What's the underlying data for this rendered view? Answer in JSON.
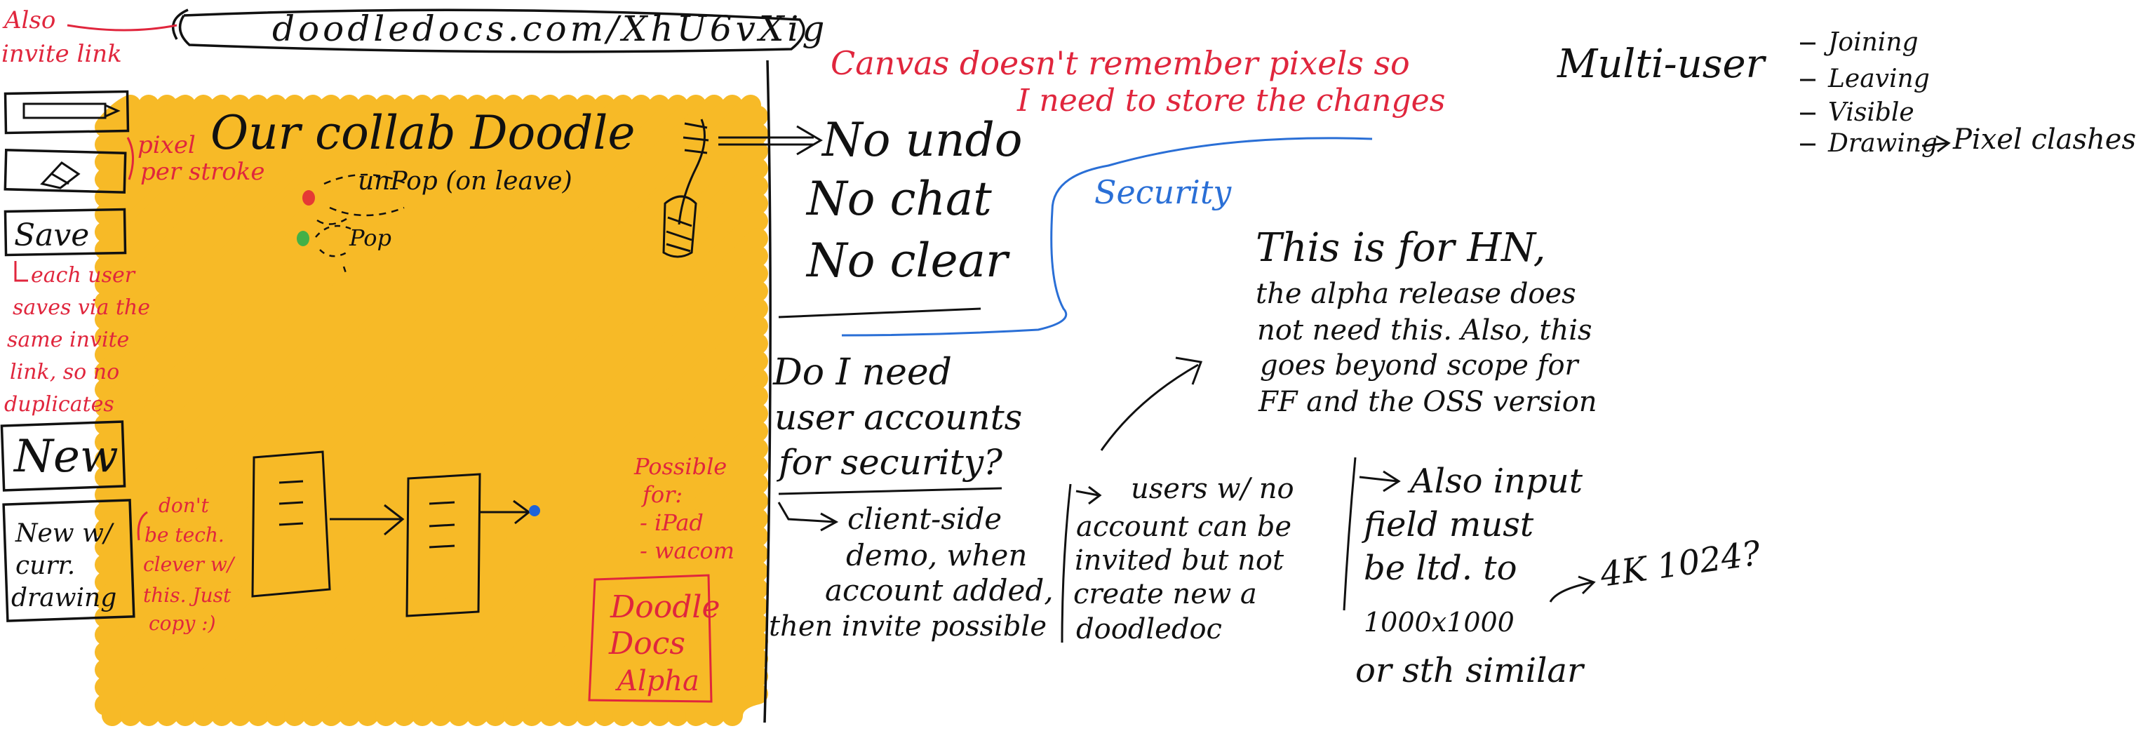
{
  "colors": {
    "ink": "#111111",
    "red": "#e0263d",
    "blue": "#2a6fd6",
    "highlight": "#f7b71c",
    "dot_red": "#e53935",
    "dot_green": "#43b047",
    "dot_blue": "#1e63d8"
  },
  "url_bar": {
    "url": "doodledocs.com/XhU6vXig"
  },
  "invite_note": {
    "line1": "Also",
    "line2": "invite link"
  },
  "toolbar": {
    "pen_icon": "pen-icon",
    "eraser_icon": "eraser-icon",
    "save_label": "Save",
    "new_label": "New",
    "new_with_current": [
      "New w/",
      "curr.",
      "drawing"
    ]
  },
  "pixel_note": {
    "line1": "pixel",
    "line2": "per stroke"
  },
  "save_note": [
    "each user",
    "saves via the",
    "same invite",
    "link, so no",
    "duplicates"
  ],
  "new_note": [
    "don't",
    "be tech.",
    "clever w/",
    "this. Just",
    "copy :)"
  ],
  "canvas": {
    "title": "Our collab Doodle",
    "unpop": "unPop (on leave)",
    "pop": "Pop"
  },
  "device_note": [
    "Possible",
    "for:",
    "- iPad",
    "- wacom"
  ],
  "alpha_stamp": [
    "Doodle",
    "Docs",
    "Alpha"
  ],
  "features_list": [
    "No undo",
    "No chat",
    "No clear"
  ],
  "canvas_note": [
    "Canvas doesn't remember pixels so",
    "I need to store the changes"
  ],
  "security": {
    "tag": "Security",
    "question": [
      "Do I need",
      "user accounts",
      "for security?"
    ],
    "answer": [
      "client-side",
      "demo, when",
      "account added,",
      "then invite possible"
    ],
    "users": [
      "users w/ no",
      "account can be",
      "invited but not",
      "create new a",
      "doodledoc"
    ],
    "input": [
      "Also input",
      "field must",
      "be ltd. to",
      "1000x1000",
      "or sth similar"
    ],
    "fourk": "4K 1024?",
    "hn": "This is for HN,",
    "hn_detail": [
      "the alpha release does",
      "not need this. Also, this",
      "goes beyond scope for",
      "FF and the OSS version"
    ]
  },
  "multi_user": {
    "title": "Multi-user",
    "items": [
      "Joining",
      "Leaving",
      "Visible",
      "Drawing"
    ],
    "clashes": "Pixel clashes"
  }
}
